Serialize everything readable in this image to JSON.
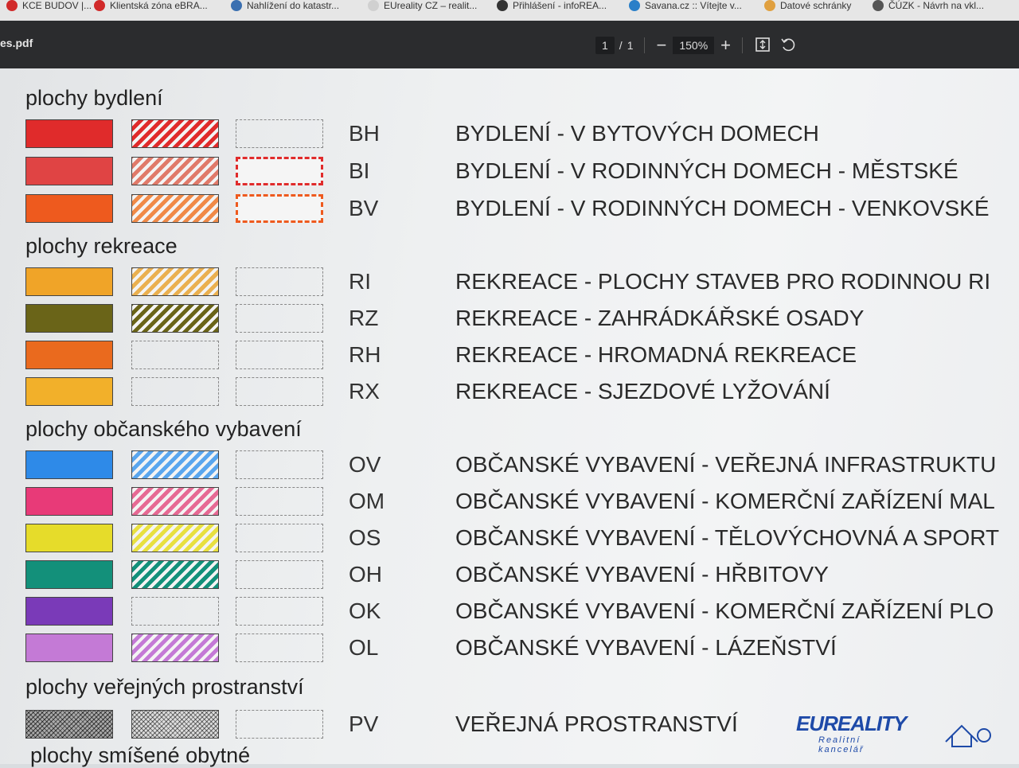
{
  "bookmarks": [
    {
      "label": "KCE BUDOV |...",
      "color": "#d12a2a"
    },
    {
      "label": "Klientská zóna eBRA...",
      "color": "#d12a2a"
    },
    {
      "label": "Nahlížení do katastr...",
      "color": "#3a6fb0"
    },
    {
      "label": "EUreality CZ – realit...",
      "color": "#d0d0d0"
    },
    {
      "label": "Přihlášení - infoREA...",
      "color": "#333333"
    },
    {
      "label": "Savana.cz :: Vítejte v...",
      "color": "#2a7fc8"
    },
    {
      "label": "Datové schránky",
      "color": "#e0a040"
    },
    {
      "label": "ČÚZK - Návrh na vkl...",
      "color": "#555555"
    }
  ],
  "viewer": {
    "filename": "es.pdf",
    "page_current": "1",
    "page_sep": "/",
    "page_total": "1",
    "zoom_out": "−",
    "zoom": "150%",
    "zoom_in": "+",
    "fit_icon": "fit-page-icon",
    "rotate_icon": "rotate-icon"
  },
  "sections": [
    {
      "title": "plochy bydlení",
      "rows": [
        {
          "code": "BH",
          "desc": "BYDLENÍ - V BYTOVÝCH DOMECH",
          "color": "#e02b2b",
          "hatch": "#e02b2b",
          "third": "dash"
        },
        {
          "code": "BI",
          "desc": "BYDLENÍ - V RODINNÝCH DOMECH - MĚSTSKÉ",
          "color": "#e04444",
          "hatch": "#e07a6a",
          "third": "redstripe"
        },
        {
          "code": "BV",
          "desc": "BYDLENÍ - V RODINNÝCH DOMECH - VENKOVSKÉ",
          "color": "#ee5a1e",
          "hatch": "#f08a48",
          "third": "orangestripe"
        }
      ]
    },
    {
      "title": "plochy rekreace",
      "rows": [
        {
          "code": "RI",
          "desc": "REKREACE - PLOCHY STAVEB PRO RODINNOU RI",
          "color": "#f0a428",
          "hatch": "#eab050",
          "third": "dash"
        },
        {
          "code": "RZ",
          "desc": "REKREACE - ZAHRÁDKÁŘSKÉ OSADY",
          "color": "#6a6418",
          "hatch": "#6a6418",
          "third": "dash"
        },
        {
          "code": "RH",
          "desc": "REKREACE - HROMADNÁ REKREACE",
          "color": "#ea6a1e",
          "hatch": "",
          "third": "dash"
        },
        {
          "code": "RX",
          "desc": "REKREACE - SJEZDOVÉ LYŽOVÁNÍ",
          "color": "#f2b02a",
          "hatch": "",
          "third": "dash"
        }
      ]
    },
    {
      "title": "plochy občanského vybavení",
      "rows": [
        {
          "code": "OV",
          "desc": "OBČANSKÉ VYBAVENÍ - VEŘEJNÁ INFRASTRUKTU",
          "color": "#2e8ae8",
          "hatch": "#5aa6ee",
          "third": "dash"
        },
        {
          "code": "OM",
          "desc": "OBČANSKÉ VYBAVENÍ - KOMERČNÍ ZAŘÍZENÍ MAL",
          "color": "#e83a78",
          "hatch": "#e66a94",
          "third": "dash"
        },
        {
          "code": "OS",
          "desc": "OBČANSKÉ VYBAVENÍ - TĚLOVÝCHOVNÁ A SPORT",
          "color": "#e6dc2a",
          "hatch": "#e8e040",
          "third": "dash"
        },
        {
          "code": "OH",
          "desc": "OBČANSKÉ VYBAVENÍ - HŘBITOVY",
          "color": "#13907a",
          "hatch": "#13907a",
          "third": "dash"
        },
        {
          "code": "OK",
          "desc": "OBČANSKÉ VYBAVENÍ - KOMERČNÍ ZAŘÍZENÍ PLO",
          "color": "#7a3ab8",
          "hatch": "",
          "third": "dash"
        },
        {
          "code": "OL",
          "desc": "OBČANSKÉ VYBAVENÍ - LÁZEŇSTVÍ",
          "color": "#c47ad6",
          "hatch": "#c47ad6",
          "third": "dash"
        }
      ]
    },
    {
      "title": "plochy veřejných prostranství",
      "rows": [
        {
          "code": "PV",
          "desc": "VEŘEJNÁ PROSTRANSTVÍ",
          "color": "crosshatch-dark",
          "hatch": "crosshatch-light",
          "third": "dash"
        }
      ]
    }
  ],
  "cut_section": "plochy smíšené obytné",
  "logo": {
    "name": "EUREALITY",
    "sub": "Realitní kancelář",
    "star_color": "#f5c400"
  }
}
